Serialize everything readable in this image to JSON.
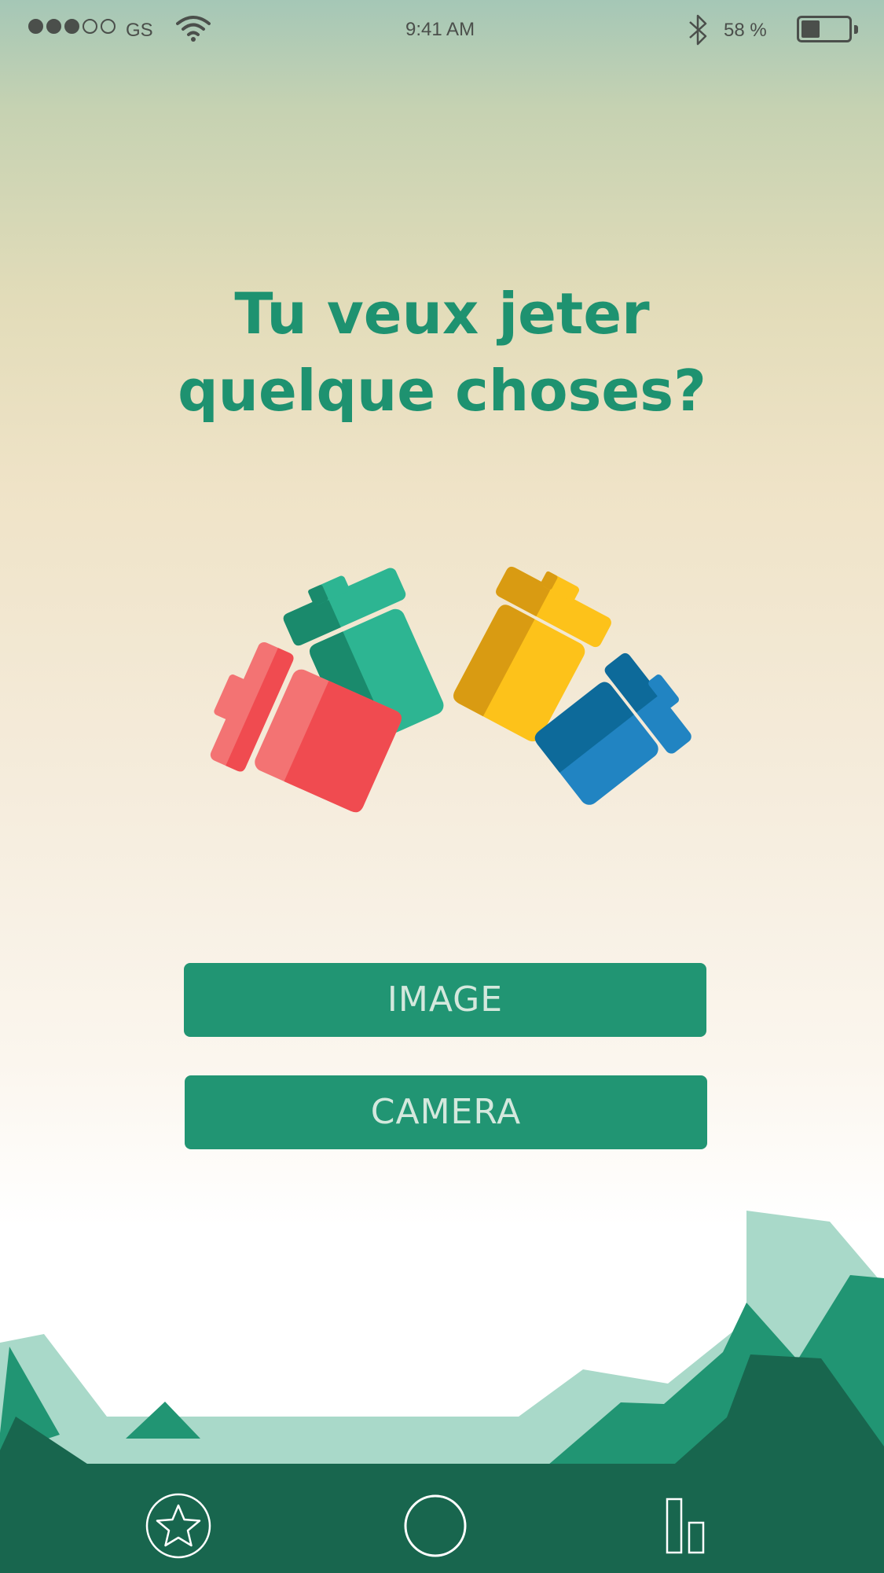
{
  "status_bar": {
    "carrier": "GS",
    "signal_bars_filled": 3,
    "signal_bars_total": 5,
    "time": "9:41 AM",
    "battery_percent_label": "58 %",
    "battery_level": 0.4,
    "icons": [
      "wifi-icon",
      "bluetooth-icon",
      "battery-icon"
    ]
  },
  "main": {
    "title_line1": "Tu veux jeter",
    "title_line2": "quelque choses?",
    "illustration": [
      "red-bin-icon",
      "green-bin-icon",
      "yellow-bin-icon",
      "blue-bin-icon"
    ],
    "buttons": {
      "image_label": "IMAGE",
      "camera_label": "CAMERA"
    }
  },
  "tab_bar": {
    "items": [
      "star-icon",
      "circle-icon",
      "stats-icon"
    ]
  },
  "colors": {
    "accent": "#219573",
    "title": "#1e9270",
    "tab_bar": "#18664e",
    "mountain_light": "#a9d9c9",
    "mountain_mid": "#219573",
    "mountain_dark": "#18664e",
    "bin_red": "#f04b50",
    "bin_green": "#1f9a7a",
    "bin_yellow": "#fdc21a",
    "bin_blue": "#1f82c0"
  }
}
